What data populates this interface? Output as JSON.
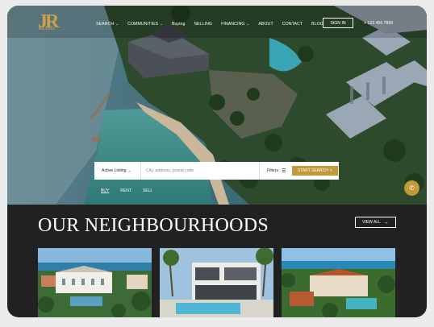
{
  "brand": {
    "logo_letters": "JR",
    "logo_tag": "RESSO"
  },
  "nav": {
    "items": [
      {
        "label": "SEARCH",
        "dropdown": true
      },
      {
        "label": "COMMUNITIES",
        "dropdown": true
      },
      {
        "label": "Buying",
        "dropdown": false
      },
      {
        "label": "SELLING",
        "dropdown": false
      },
      {
        "label": "FINANCING",
        "dropdown": true
      },
      {
        "label": "ABOUT",
        "dropdown": false
      },
      {
        "label": "CONTACT",
        "dropdown": false
      },
      {
        "label": "BLOG",
        "dropdown": false
      }
    ],
    "signin_label": "SIGN IN",
    "phone": "+ 123 456 7890"
  },
  "search": {
    "listing_label": "Active Listing",
    "placeholder": "City, address, postal code",
    "filters_label": "Filters",
    "start_label": "START SEARCH",
    "modes": [
      "BUY",
      "RENT",
      "SELL"
    ],
    "active_mode": "BUY"
  },
  "section": {
    "title": "OUR NEIGHBOURHOODS",
    "view_all_label": "VIEW ALL"
  },
  "colors": {
    "accent": "#c19a3a",
    "dark_bg": "#212121",
    "page_bg": "#ebebeb"
  },
  "icons": {
    "call": "phone-icon",
    "filters": "sliders-icon",
    "search": "search-icon",
    "arrow": "arrow-right-icon",
    "chevron": "chevron-down-icon"
  }
}
